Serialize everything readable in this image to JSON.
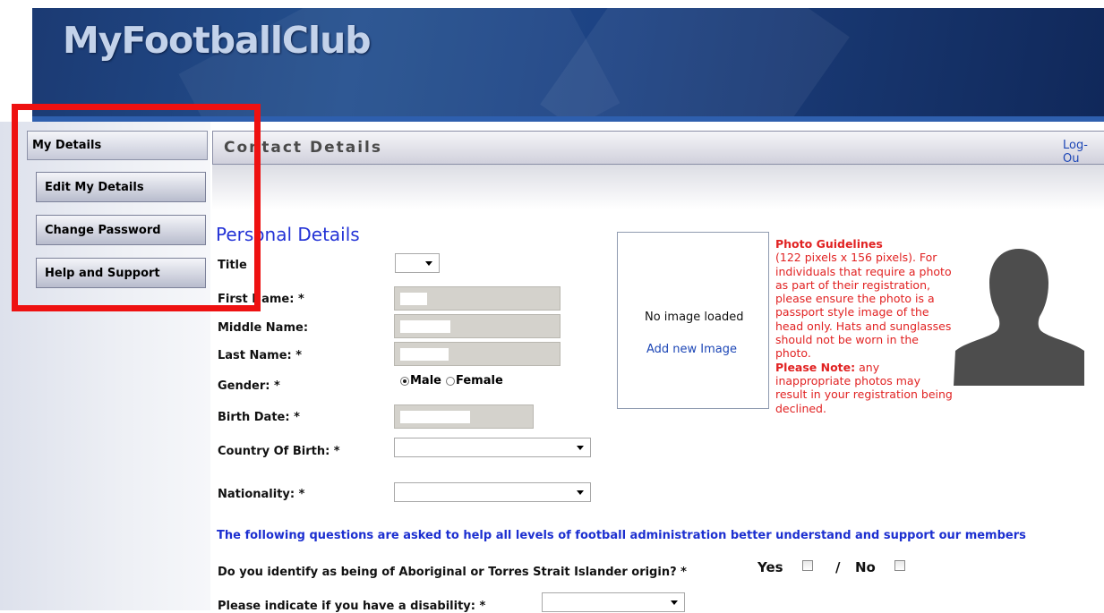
{
  "header": {
    "logo_text": "MyFootballClub"
  },
  "sidebar": {
    "heading": "My Details",
    "items": [
      {
        "label": "Edit My Details"
      },
      {
        "label": "Change Password"
      },
      {
        "label": "Help and Support"
      }
    ]
  },
  "content": {
    "title": "Contact Details",
    "logout_label": "Log-Ou",
    "section_title": "Personal Details"
  },
  "form": {
    "title_label": "Title",
    "first_name_label": "First Name: *",
    "middle_name_label": "Middle Name:",
    "last_name_label": "Last Name: *",
    "gender_label": "Gender: *",
    "gender_options": [
      "Male",
      "Female"
    ],
    "gender_selected": "Male",
    "birth_date_label": "Birth Date: *",
    "country_label": "Country Of Birth: *",
    "nationality_label": "Nationality: *"
  },
  "photo": {
    "no_image": "No image loaded",
    "add_image": "Add new Image",
    "guidelines_title": "Photo Guidelines",
    "guidelines_text": "(122 pixels x 156 pixels). For individuals that require a photo as part of their registration, please ensure the photo is a passport style image of the head only. Hats and sunglasses should not be worn in the photo.",
    "note_title": "Please Note:",
    "note_text": " any inappropriate photos may result in your registration being declined."
  },
  "questions": {
    "intro": "The following questions are asked to help all levels of football administration better understand and support our members",
    "aboriginal_label": "Do you identify as being of Aboriginal or Torres Strait Islander origin? *",
    "yes_label": "Yes",
    "separator": "/",
    "no_label": "No",
    "disability_label": "Please indicate if you have a disability: *"
  },
  "colors": {
    "highlight_box": "#ee1111",
    "link": "#1c46b6",
    "guideline_text": "#e12222"
  }
}
